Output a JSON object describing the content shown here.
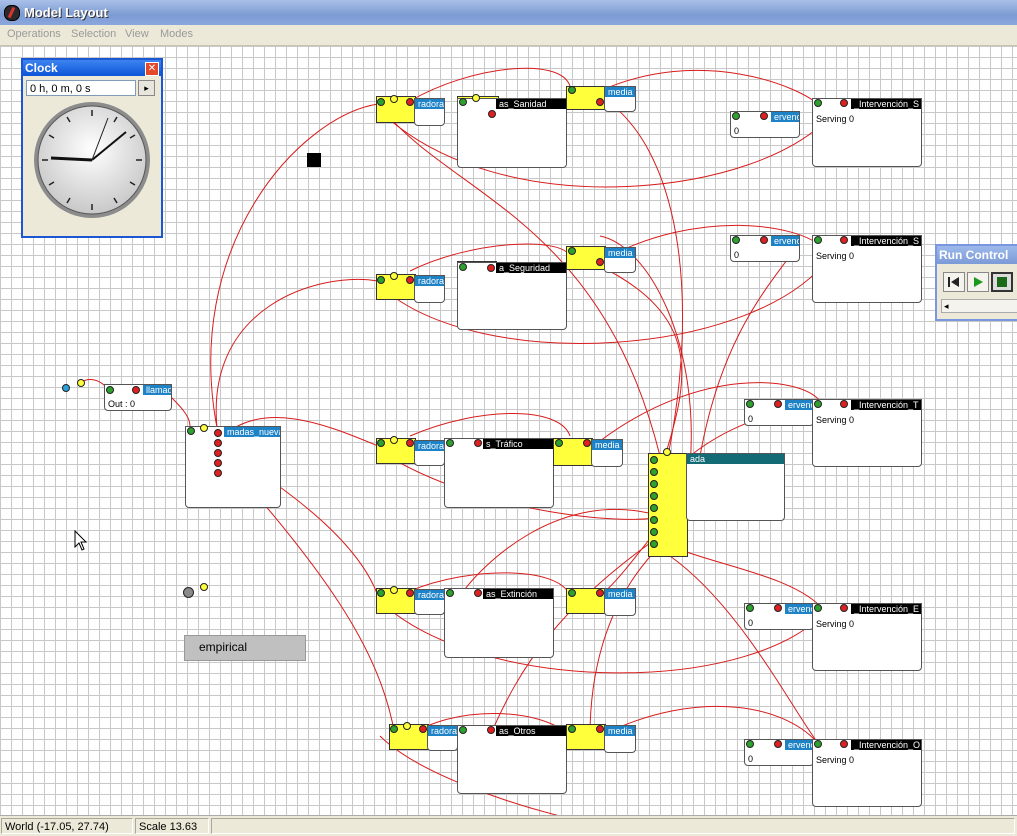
{
  "window": {
    "title": "Model Layout",
    "icon": "app-logo-icon"
  },
  "menu": [
    "Operations",
    "Selection",
    "View",
    "Modes"
  ],
  "clock": {
    "title": "Clock",
    "time": "0 h, 0 m, 0 s",
    "icon": "clock-face-icon"
  },
  "run_control": {
    "title": "Run Control",
    "buttons": [
      "reset-icon",
      "play-icon",
      "stop-icon"
    ]
  },
  "nodes": {
    "sanidad_gen": "radora",
    "sanidad_queue": "as_Sanidad",
    "sanidad_media": "media",
    "sanidad_int_label": "ervenc",
    "sanidad_int_value": "0",
    "sanidad_int_server": "_Intervención_S",
    "sanidad_serving": "Serving 0",
    "seguridad_gen": "radora",
    "seguridad_queue": "a_Seguridad",
    "seguridad_media": "media",
    "seguridad_int_label": "ervenc",
    "seguridad_int_value": "0",
    "seguridad_int_server": "_Intervención_S",
    "seguridad_serving": "Serving 0",
    "llamad_label": "llamad",
    "llamad_out": "Out : 0",
    "nuevas_label": "madas_nueva",
    "trafico_gen": "radora",
    "trafico_queue": "s_Tráfico",
    "trafico_media": "media",
    "trafico_int_label": "ervenc",
    "trafico_int_value": "0",
    "trafico_int_server": "_Intervención_T",
    "trafico_serving": "Serving 0",
    "ada_label": "ada",
    "extincion_gen": "radora",
    "extincion_queue": "as_Extinción",
    "extincion_media": "media",
    "extincion_int_label": "ervenc",
    "extincion_int_value": "0",
    "extincion_int_server": "_Intervención_E",
    "extincion_serving": "Serving 0",
    "otros_gen": "radora",
    "otros_queue": "as_Otros",
    "otros_media": "media",
    "otros_int_label": "ervenc",
    "otros_int_value": "0",
    "otros_int_server": "_Intervención_O",
    "otros_serving": "Serving 0",
    "empirical": "empirical"
  },
  "status": {
    "world": "World (-17.05, 27.74)",
    "scale": "Scale 13.63"
  },
  "colors": {
    "wire": "#d81c1c",
    "port_fill": "#ffff3c",
    "header": "#000000",
    "header_blue": "#1e82c6"
  }
}
